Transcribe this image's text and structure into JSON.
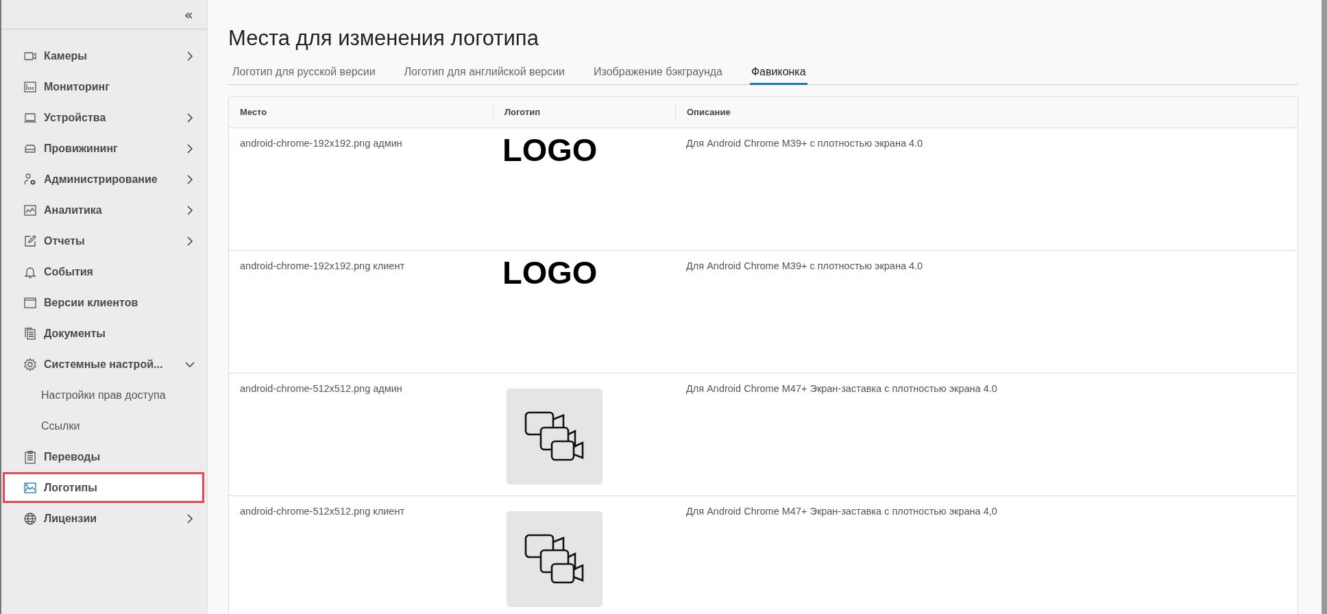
{
  "sidebar": {
    "collapse_icon": "«",
    "items": [
      {
        "label": "Камеры",
        "expanded": false,
        "selected": false
      },
      {
        "label": "Мониторинг",
        "selected": false
      },
      {
        "label": "Устройства",
        "expanded": false,
        "selected": false
      },
      {
        "label": "Провижининг",
        "expanded": false,
        "selected": false
      },
      {
        "label": "Администрирование",
        "expanded": false,
        "selected": false
      },
      {
        "label": "Аналитика",
        "expanded": false,
        "selected": false
      },
      {
        "label": "Отчеты",
        "expanded": false,
        "selected": false
      },
      {
        "label": "События",
        "selected": false
      },
      {
        "label": "Версии клиентов",
        "selected": false
      },
      {
        "label": "Документы",
        "selected": false
      },
      {
        "label": "Системные настрой...",
        "expanded": true,
        "selected": false,
        "children": [
          {
            "label": "Настройки прав доступа",
            "selected": false
          },
          {
            "label": "Ссылки",
            "selected": false
          }
        ]
      },
      {
        "label": "Переводы",
        "selected": false
      },
      {
        "label": "Логотипы",
        "selected": true
      },
      {
        "label": "Лицензии",
        "expanded": false,
        "selected": false
      }
    ]
  },
  "page": {
    "title": "Места для изменения логотипа",
    "tabs": [
      {
        "label": "Логотип для русской версии",
        "selected": false
      },
      {
        "label": "Логотип для английской версии",
        "selected": false
      },
      {
        "label": "Изображение бэкграунда",
        "selected": false
      },
      {
        "label": "Фавиконка",
        "selected": true
      }
    ],
    "table": {
      "columns": [
        "Место",
        "Логотип",
        "Описание"
      ],
      "rows": [
        {
          "place": "android-chrome-192x192.png админ",
          "logo": {
            "kind": "text",
            "text": "LOGO"
          },
          "description": "Для Android Chrome M39+ с плотностью экрана 4.0"
        },
        {
          "place": "android-chrome-192x192.png клиент",
          "logo": {
            "kind": "text",
            "text": "LOGO"
          },
          "description": "Для Android Chrome M39+ с плотностью экрана 4.0"
        },
        {
          "place": "android-chrome-512x512.png админ",
          "logo": {
            "kind": "cameras"
          },
          "description": "Для Android Chrome M47+ Экран-заставка с плотностью экрана 4.0"
        },
        {
          "place": "android-chrome-512x512.png клиент",
          "logo": {
            "kind": "cameras"
          },
          "description": "Для Android Chrome M47+ Экран-заставка с плотностью экрана 4,0"
        }
      ]
    }
  }
}
